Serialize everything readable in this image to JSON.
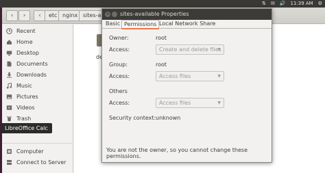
{
  "panel": {
    "indicators": [
      "⇅",
      "✉",
      "🔊",
      "11:39 AM",
      "⚙"
    ]
  },
  "file_manager": {
    "breadcrumbs": [
      "etc",
      "nginx",
      "sites-av"
    ],
    "sidebar": {
      "places": [
        {
          "label": "Recent",
          "icon": "clock-icon"
        },
        {
          "label": "Home",
          "icon": "home-icon"
        },
        {
          "label": "Desktop",
          "icon": "desktop-icon"
        },
        {
          "label": "Documents",
          "icon": "documents-icon"
        },
        {
          "label": "Downloads",
          "icon": "downloads-icon"
        },
        {
          "label": "Music",
          "icon": "music-icon"
        },
        {
          "label": "Pictures",
          "icon": "pictures-icon"
        },
        {
          "label": "Videos",
          "icon": "videos-icon"
        },
        {
          "label": "Trash",
          "icon": "trash-icon"
        }
      ],
      "devices": [
        {
          "label": "Computer",
          "icon": "computer-icon"
        },
        {
          "label": "Connect to Server",
          "icon": "server-icon"
        }
      ]
    },
    "file_label": "def"
  },
  "tooltip": "LibreOffice Calc",
  "dialog": {
    "title": "sites-available Properties",
    "tabs": [
      "Basic",
      "Permissions",
      "Local Network Share"
    ],
    "active_tab": "Permissions",
    "owner_label": "Owner:",
    "owner_value": "root",
    "owner_access_label": "Access:",
    "owner_access_value": "Create and delete files",
    "group_label": "Group:",
    "group_value": "root",
    "group_access_label": "Access:",
    "group_access_value": "Access files",
    "others_label": "Others",
    "others_access_label": "Access:",
    "others_access_value": "Access files",
    "context_label": "Security context:",
    "context_value": "unknown",
    "note": "You are not the owner, so you cannot change these permissions."
  }
}
